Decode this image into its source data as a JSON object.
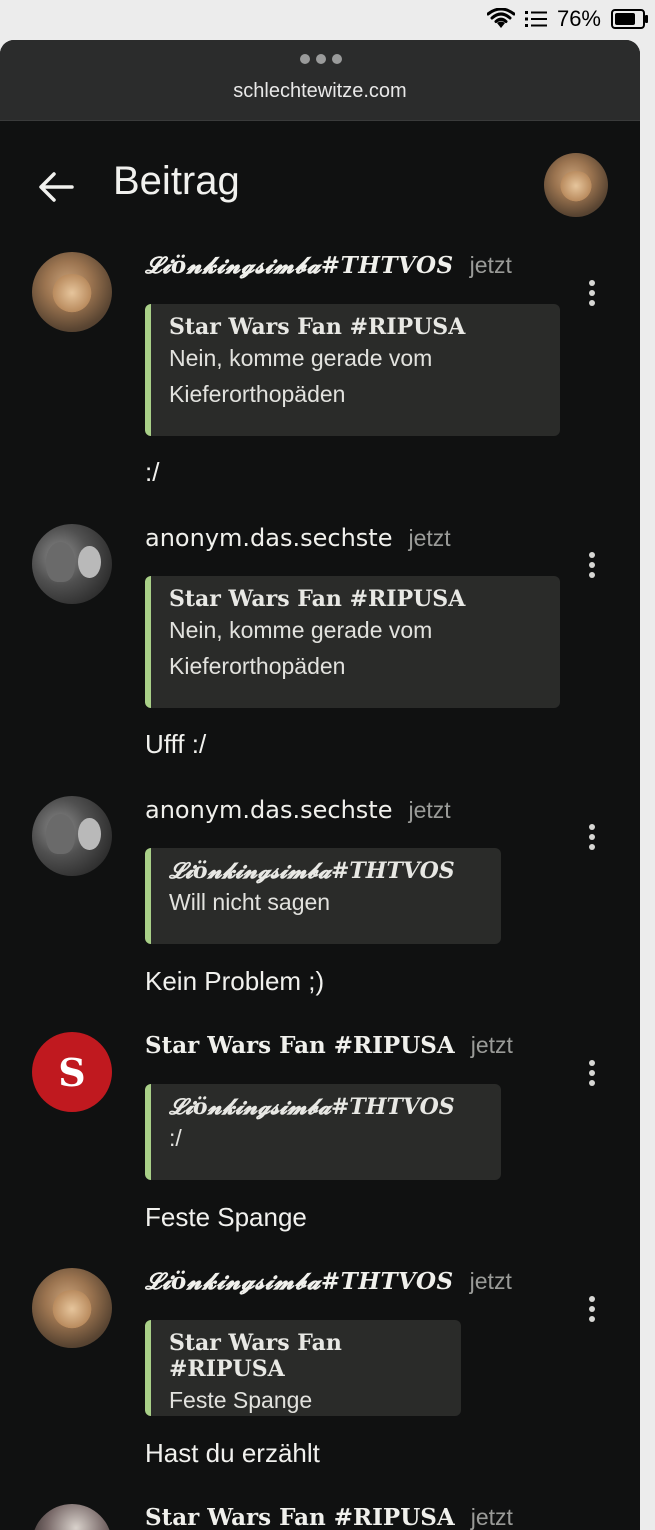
{
  "status": {
    "battery_percent": "76%",
    "battery_level": 0.76,
    "icons": [
      "wifi-icon",
      "list-icon",
      "battery-icon"
    ]
  },
  "browser": {
    "url": "schlechtewitze.com"
  },
  "appbar": {
    "title": "Beitrag",
    "back_icon": "arrow-left-icon"
  },
  "posts": [
    {
      "author": "𝓛𝓲ö𝓷𝓴𝓲𝓷𝓰𝓼𝓲𝓶𝓫𝓪#THTVOS",
      "time": "jetzt",
      "avatar": "lion",
      "quote_author": "Star Wars Fan #RIPUSA",
      "quote_text": "Nein, komme gerade vom Kieferorthopäden",
      "text": ":/"
    },
    {
      "author": "anonym.das.sechste",
      "time": "jetzt",
      "avatar": "anime",
      "quote_author": "Star Wars Fan #RIPUSA",
      "quote_text": "Nein, komme gerade vom Kieferorthopäden",
      "text": "Ufff :/"
    },
    {
      "author": "anonym.das.sechste",
      "time": "jetzt",
      "avatar": "anime",
      "quote_author": "𝓛𝓲ö𝓷𝓴𝓲𝓷𝓰𝓼𝓲𝓶𝓫𝓪#THTVOS",
      "quote_text": "Will nicht sagen",
      "text": "Kein Problem ;)"
    },
    {
      "author": "Star Wars Fan #RIPUSA",
      "time": "jetzt",
      "avatar": "S",
      "quote_author": "𝓛𝓲ö𝓷𝓴𝓲𝓷𝓰𝓼𝓲𝓶𝓫𝓪#THTVOS",
      "quote_text": ":/",
      "text": "Feste Spange"
    },
    {
      "author": "𝓛𝓲ö𝓷𝓴𝓲𝓷𝓰𝓼𝓲𝓶𝓫𝓪#THTVOS",
      "time": "jetzt",
      "avatar": "lion",
      "quote_author": "Star Wars Fan #RIPUSA",
      "quote_text": "Feste Spange",
      "text": "Hast du erzählt"
    },
    {
      "author": "Star Wars Fan #RIPUSA",
      "time": "jetzt",
      "avatar": "dark"
    }
  ],
  "colors": {
    "quote_accent": "#a9d088",
    "avatar_red": "#c0191f",
    "background": "#101111"
  }
}
